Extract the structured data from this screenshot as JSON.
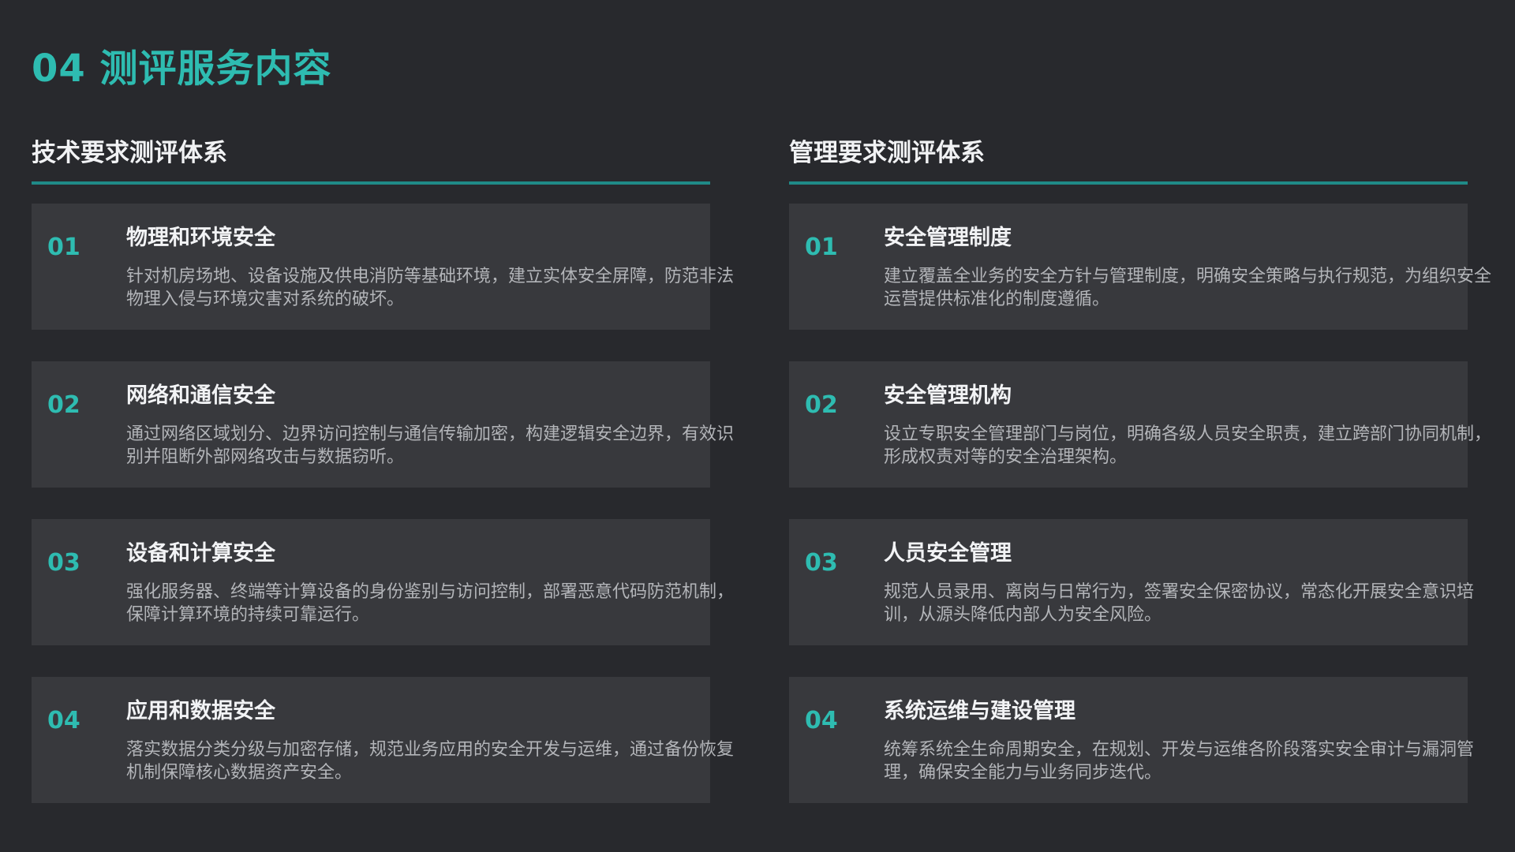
{
  "page_title": "04 测评服务内容",
  "columns": [
    {
      "header": "技术要求测评体系",
      "items": [
        {
          "num": "01",
          "title": "物理和环境安全",
          "desc": "针对机房场地、设备设施及供电消防等基础环境，建立实体安全屏障，防范非法物理入侵与环境灾害对系统的破坏。"
        },
        {
          "num": "02",
          "title": "网络和通信安全",
          "desc": "通过网络区域划分、边界访问控制与通信传输加密，构建逻辑安全边界，有效识别并阻断外部网络攻击与数据窃听。"
        },
        {
          "num": "03",
          "title": "设备和计算安全",
          "desc": "强化服务器、终端等计算设备的身份鉴别与访问控制，部署恶意代码防范机制，保障计算环境的持续可靠运行。"
        },
        {
          "num": "04",
          "title": "应用和数据安全",
          "desc": "落实数据分类分级与加密存储，规范业务应用的安全开发与运维，通过备份恢复机制保障核心数据资产安全。"
        }
      ]
    },
    {
      "header": "管理要求测评体系",
      "items": [
        {
          "num": "01",
          "title": "安全管理制度",
          "desc": "建立覆盖全业务的安全方针与管理制度，明确安全策略与执行规范，为组织安全运营提供标准化的制度遵循。"
        },
        {
          "num": "02",
          "title": "安全管理机构",
          "desc": "设立专职安全管理部门与岗位，明确各级人员安全职责，建立跨部门协同机制，形成权责对等的安全治理架构。"
        },
        {
          "num": "03",
          "title": "人员安全管理",
          "desc": "规范人员录用、离岗与日常行为，签署安全保密协议，常态化开展安全意识培训，从源头降低内部人为安全风险。"
        },
        {
          "num": "04",
          "title": "系统运维与建设管理",
          "desc": "统筹系统全生命周期安全，在规划、开发与运维各阶段落实安全审计与漏洞管理，确保安全能力与业务同步迭代。"
        }
      ]
    }
  ]
}
